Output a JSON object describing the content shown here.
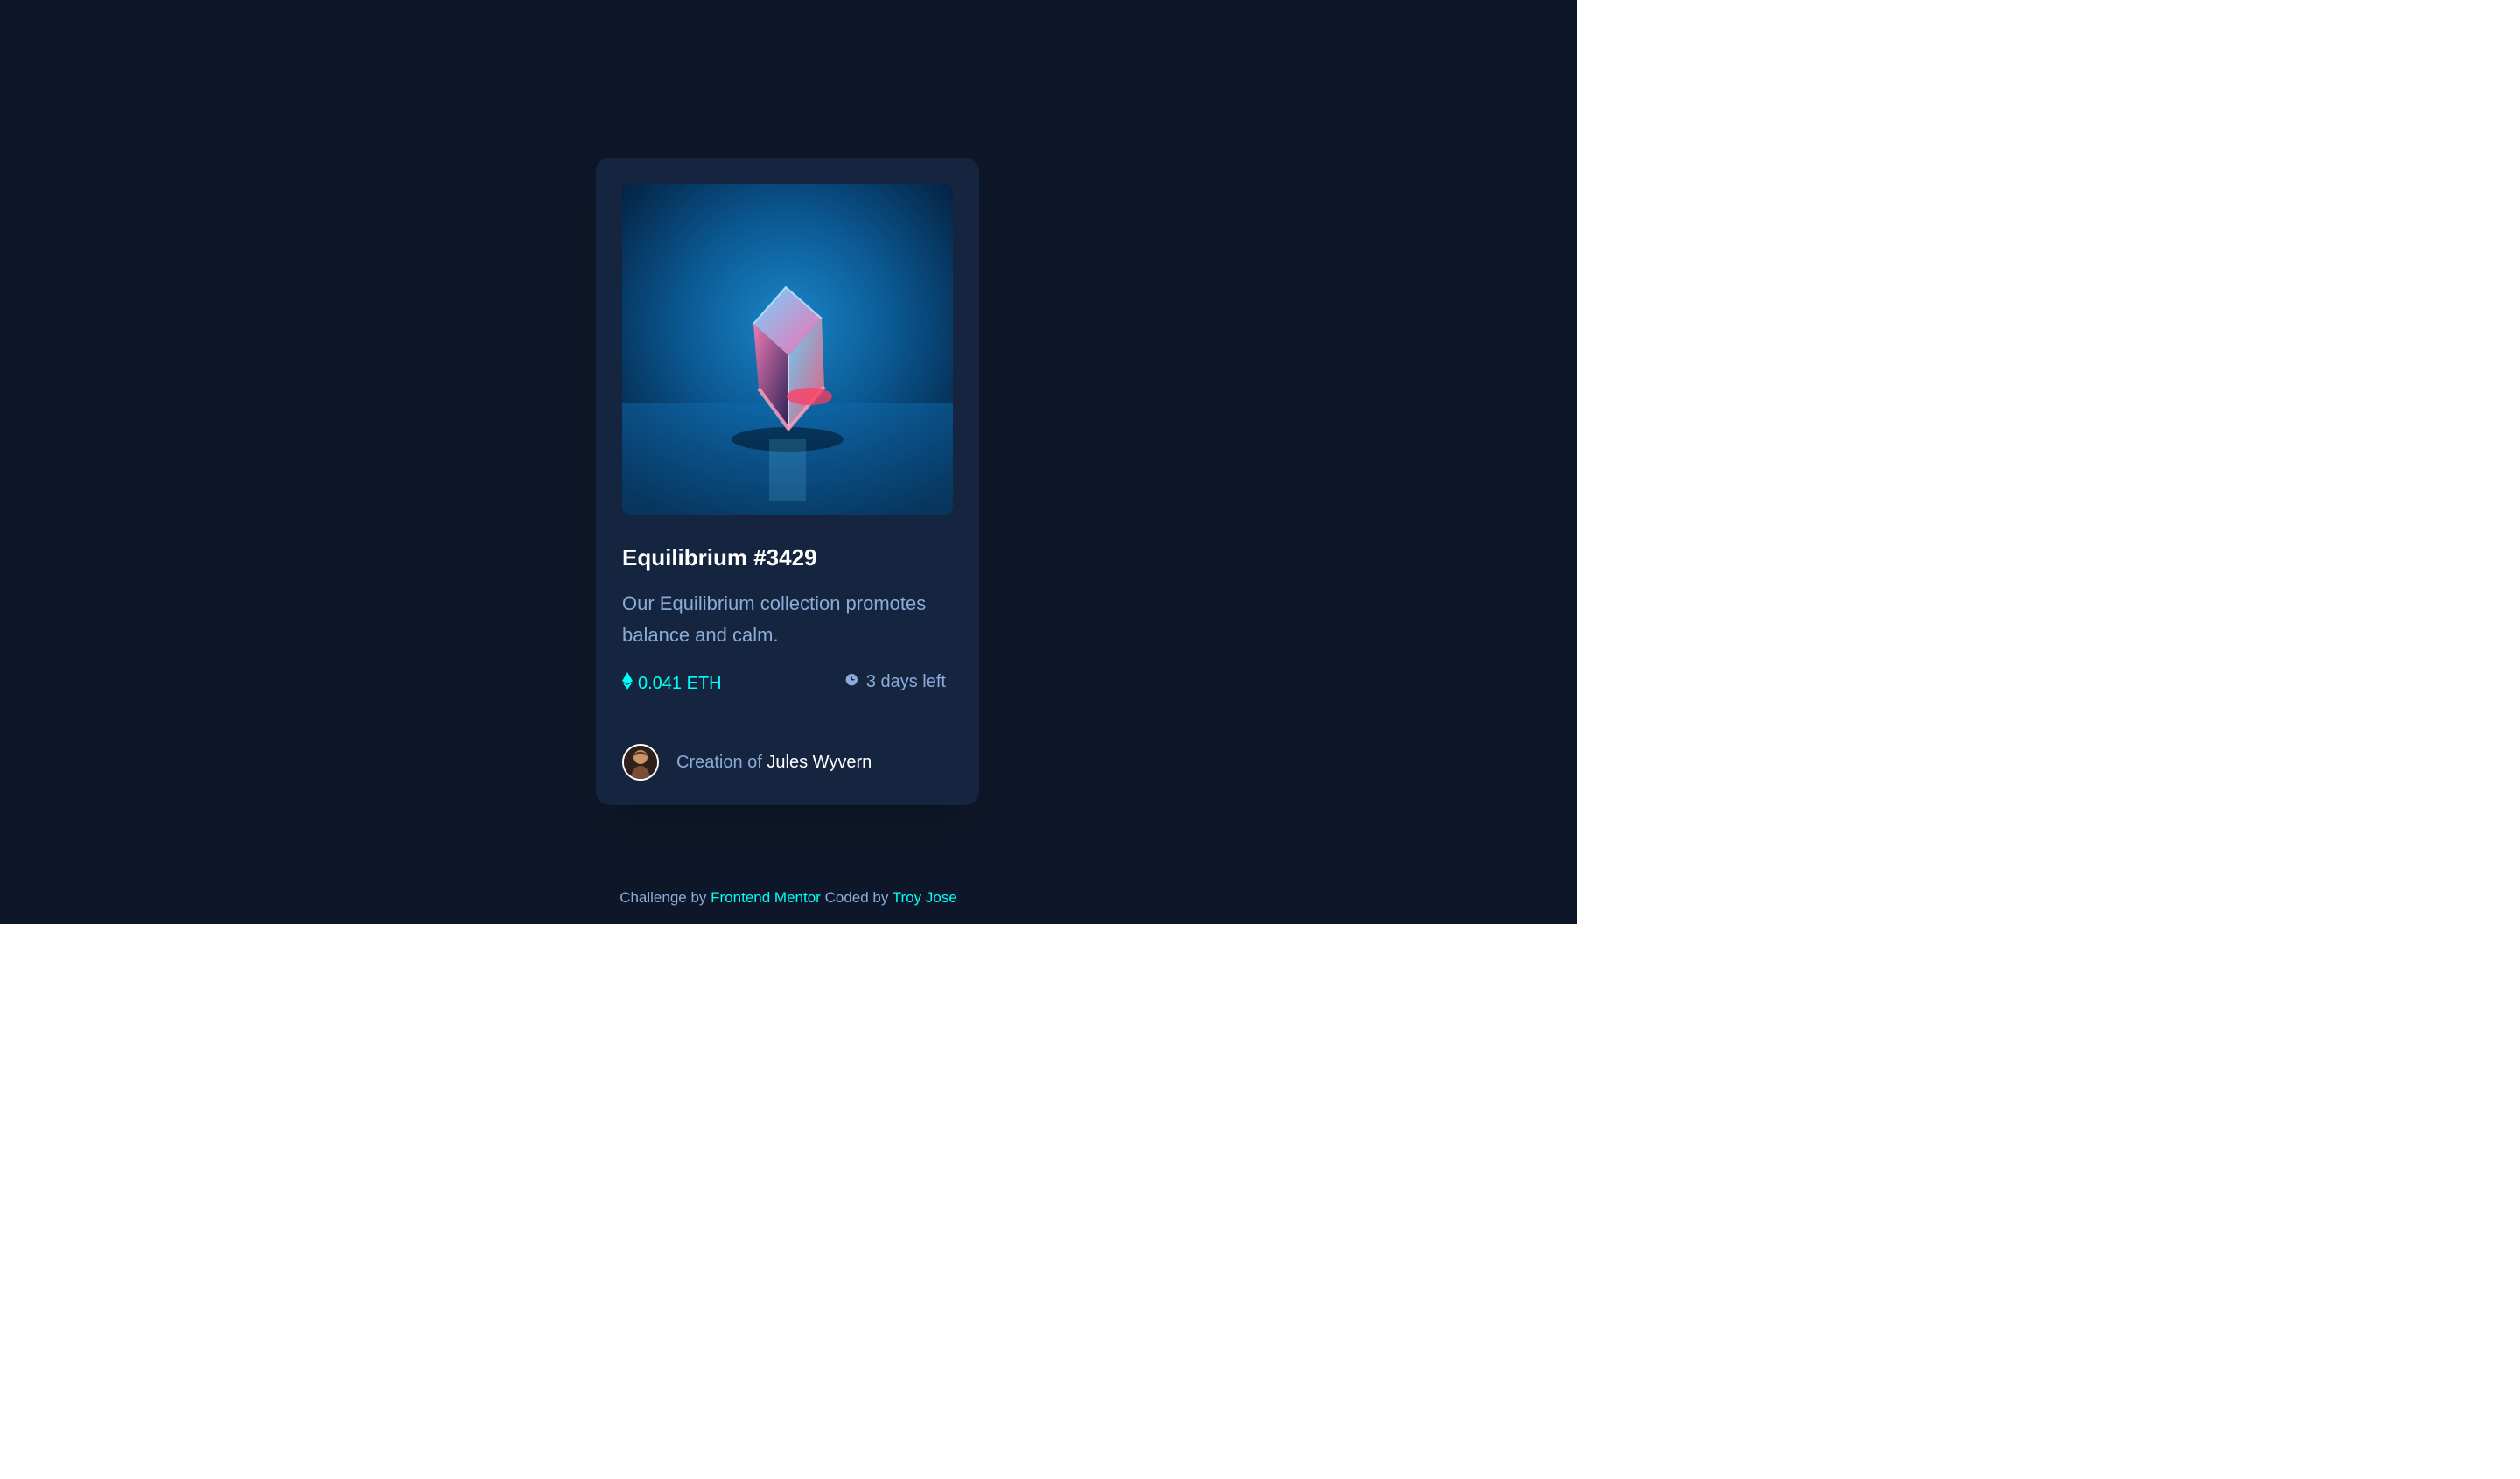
{
  "card": {
    "image_alt": "Equilibrium cube image",
    "title": "Equilibrium #3429",
    "description": "Our Equilibrium collection promotes balance and calm.",
    "price": "0.041 ETH",
    "time_left": "3 days left",
    "creator_label": "Creation of",
    "creator_name": "Jules Wyvern"
  },
  "attribution": {
    "challenge_prefix": "Challenge by",
    "challenge_link": "Frontend Mentor",
    "coded_prefix": "Coded by",
    "author_link": "Troy Jose"
  },
  "colors": {
    "page_background": "#0e1729",
    "card_background": "#15253f",
    "accent_cyan": "#00fff8",
    "soft_blue": "#8bacd9",
    "white": "#ffffff"
  },
  "icons": {
    "price": "ethereum-icon",
    "time": "clock-icon"
  }
}
